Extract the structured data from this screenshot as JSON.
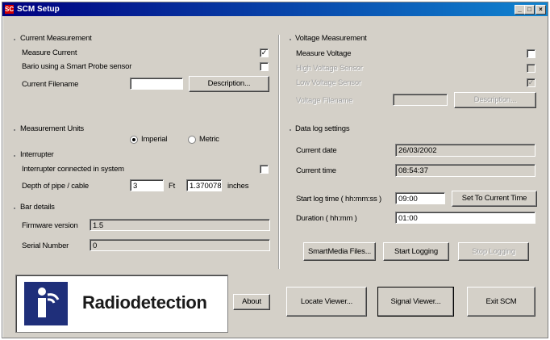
{
  "window": {
    "title": "SCM Setup",
    "icon_text": "SC"
  },
  "current_measurement": {
    "heading": "Current Measurement",
    "measure_current_label": "Measure Current",
    "measure_current_checked": true,
    "bario_label": "Bario using a Smart Probe sensor",
    "bario_checked": false,
    "filename_label": "Current Filename",
    "filename_value": "",
    "description_button": "Description..."
  },
  "measurement_units": {
    "heading": "Measurement Units",
    "imperial_label": "Imperial",
    "metric_label": "Metric",
    "selected": "Imperial"
  },
  "interrupter": {
    "heading": "Interrupter",
    "connected_label": "Interrupter connected in system",
    "connected_checked": false,
    "depth_label": "Depth of pipe / cable",
    "depth_ft_value": "3",
    "ft_unit": "Ft",
    "depth_in_value": "1.370078",
    "in_unit": "inches"
  },
  "bar_details": {
    "heading": "Bar details",
    "firmware_label": "Firmware version",
    "firmware_value": "1.5",
    "serial_label": "Serial Number",
    "serial_value": "0"
  },
  "voltage_measurement": {
    "heading": "Voltage Measurement",
    "measure_voltage_label": "Measure Voltage",
    "measure_voltage_checked": false,
    "high_voltage_label": "High Voltage Sensor",
    "high_voltage_checked": false,
    "low_voltage_label": "Low Voltage Sensor",
    "low_voltage_checked": true,
    "filename_label": "Voltage Filename",
    "filename_value": "",
    "description_button": "Description..."
  },
  "data_log": {
    "heading": "Data log settings",
    "current_date_label": "Current date",
    "current_date_value": "26/03/2002",
    "current_time_label": "Current time",
    "current_time_value": "08:54:37",
    "start_time_label": "Start log time ( hh:mm:ss )",
    "start_time_value": "09:00",
    "set_current_time_button": "Set To Current Time",
    "duration_label": "Duration ( hh:mm )",
    "duration_value": "01:00",
    "smartmedia_button": "SmartMedia Files...",
    "start_logging_button": "Start Logging",
    "stop_logging_button": "Stop Logging"
  },
  "logo": {
    "text": "Radiodetection"
  },
  "bottom_buttons": {
    "about": "About",
    "locate_viewer": "Locate Viewer...",
    "signal_viewer": "Signal Viewer...",
    "exit": "Exit SCM"
  },
  "check_glyph": "✓"
}
